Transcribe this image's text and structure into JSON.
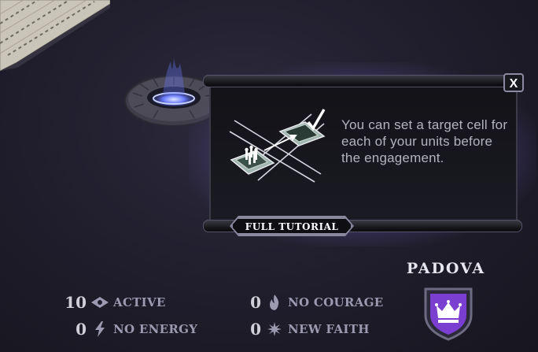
{
  "tutorial": {
    "text": "You can set a target cell for each of your units before the engagement.",
    "full_tutorial_label": "FULL TUTORIAL",
    "close_label": "X"
  },
  "city": {
    "name": "PADOVA",
    "shield_color": "#7a3fd0",
    "emblem_icon": "crown-icon"
  },
  "stats": [
    {
      "value": "10",
      "label": "ACTIVE",
      "icon": "eye-diamond-icon"
    },
    {
      "value": "0",
      "label": "NO ENERGY",
      "icon": "lightning-icon"
    },
    {
      "value": "0",
      "label": "NO COURAGE",
      "icon": "flame-icon"
    },
    {
      "value": "0",
      "label": "NEW FAITH",
      "icon": "starburst-icon"
    }
  ],
  "colors": {
    "background": "#1f1d2b",
    "panel_glow": "#917dd7",
    "portal_fire": "#6a7cff",
    "text_muted": "#9b9ab0"
  }
}
